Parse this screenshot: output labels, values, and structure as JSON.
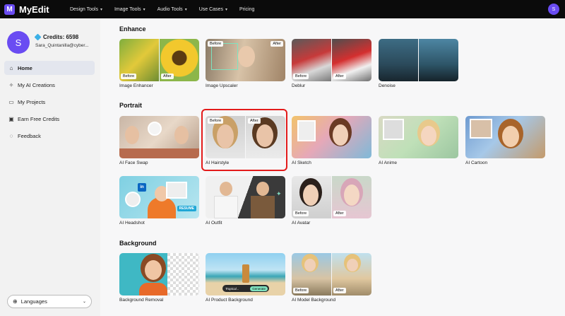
{
  "brand": {
    "name": "MyEdit",
    "logo_letter": "M"
  },
  "nav": {
    "items": [
      {
        "label": "Design Tools",
        "dropdown": true
      },
      {
        "label": "Image Tools",
        "dropdown": true
      },
      {
        "label": "Audio Tools",
        "dropdown": true
      },
      {
        "label": "Use Cases",
        "dropdown": true
      },
      {
        "label": "Pricing",
        "dropdown": false
      }
    ],
    "avatar_letter": "S"
  },
  "user": {
    "avatar_letter": "S",
    "credits": "Credits: 6598",
    "email": "Sara_Quintanilla@cyber..."
  },
  "sidebar": {
    "items": [
      {
        "label": "Home",
        "icon": "home-icon",
        "active": true
      },
      {
        "label": "My AI Creations",
        "icon": "sparkle-icon",
        "active": false
      },
      {
        "label": "My Projects",
        "icon": "folder-icon",
        "active": false
      },
      {
        "label": "Earn Free Credits",
        "icon": "gift-icon",
        "active": false
      },
      {
        "label": "Feedback",
        "icon": "chat-icon",
        "active": false
      }
    ],
    "language": "Languages"
  },
  "sections": {
    "enhance": {
      "title": "Enhance",
      "cards": [
        {
          "label": "Image Enhancer",
          "before": "Before",
          "after": "After"
        },
        {
          "label": "Image Upscaler",
          "before": "Before",
          "after": "After"
        },
        {
          "label": "Deblur",
          "before": "Before",
          "after": "After"
        },
        {
          "label": "Denoise",
          "before": "",
          "after": ""
        }
      ]
    },
    "portrait": {
      "title": "Portrait",
      "cards": [
        {
          "label": "AI Face Swap"
        },
        {
          "label": "AI Hairstyle",
          "before": "Before",
          "after": "After"
        },
        {
          "label": "AI Sketch"
        },
        {
          "label": "AI Anime"
        },
        {
          "label": "AI Cartoon"
        },
        {
          "label": "AI Headshot",
          "badge": "RESUME"
        },
        {
          "label": "AI Outfit"
        },
        {
          "label": "AI Avatar",
          "before": "Before",
          "after": "After"
        }
      ]
    },
    "background": {
      "title": "Background",
      "cards": [
        {
          "label": "Background Removal"
        },
        {
          "label": "AI Product Background",
          "input": "Tropical...",
          "button": "Generate"
        },
        {
          "label": "AI Model Background",
          "before": "Before",
          "after": "After"
        }
      ]
    }
  }
}
